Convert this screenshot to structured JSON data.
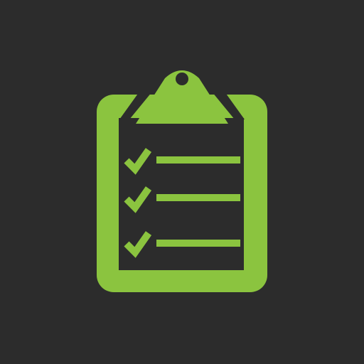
{
  "icon": {
    "name": "clipboard-checklist-icon",
    "background_color": "#2c2c2c",
    "accent_color": "#8bc43f",
    "checklist_items": [
      {
        "name": "checklist-item-1",
        "checked": true
      },
      {
        "name": "checklist-item-2",
        "checked": true
      },
      {
        "name": "checklist-item-3",
        "checked": true
      }
    ]
  }
}
